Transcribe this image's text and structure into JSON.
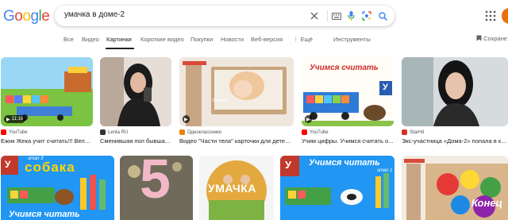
{
  "logo": {
    "text": "Google"
  },
  "search": {
    "query": "умачка в доме-2"
  },
  "tabs": [
    {
      "label": "Все"
    },
    {
      "label": "Видео"
    },
    {
      "label": "Картинки"
    },
    {
      "label": "Короткие видео"
    },
    {
      "label": "Покупки"
    },
    {
      "label": "Новости"
    },
    {
      "label": "Веб-версия"
    },
    {
      "label": "⋮ Ещё"
    },
    {
      "label": "Инструменты"
    }
  ],
  "save_label": "Сохране",
  "results": [
    {
      "source": "YouTube",
      "caption": "Ежик Жека учит считать!!! Вели...",
      "duration": "11:16",
      "favicon_color": "#ff0000"
    },
    {
      "source": "Lenta RU",
      "caption": "Сменившая пол бывша...",
      "favicon_color": "#333333"
    },
    {
      "source": "Одноклассники",
      "caption": "Видео \"Части тела\" карточки для детей ...",
      "favicon_color": "#ee8208"
    },
    {
      "source": "YouTube",
      "caption": "Учим цифры. Учимся считать о...",
      "favicon_color": "#ff0000"
    },
    {
      "source": "StarHit",
      "caption": "Экс-участница «Дома-2» попала в крим",
      "favicon_color": "#d93025"
    }
  ],
  "thumb_texts": {
    "card3_label": "Волосы",
    "card4_title": "Учимся считать",
    "card4_letter": "У",
    "row2_a_top": "этап 3",
    "row2_a_word": "собака",
    "row2_a_bottom": "Учимся читать",
    "row2_b_number": "5",
    "row2_c_word": "УМАЧКА",
    "row2_d_title": "Учимся читать",
    "row2_d_sub": "этап 1",
    "row2_e_word": "Конец"
  }
}
